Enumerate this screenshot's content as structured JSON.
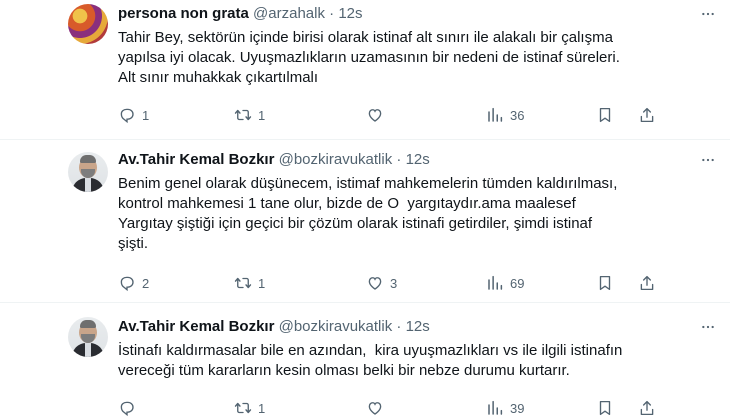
{
  "tweets": [
    {
      "name": "persona non grata",
      "handle": "@arzahalk",
      "dot": "·",
      "time": "12s",
      "text": "Tahir Bey, sektörün içinde birisi olarak istinaf alt sınırı ile alakalı bir çalışma\nyapılsa iyi olacak. Uyuşmazlıkların uzamasının bir nedeni de istinaf süreleri.\nAlt sınır muhakkak çıkartılmalı",
      "replies": "1",
      "retweets": "1",
      "likes": "",
      "views": "36"
    },
    {
      "name": "Av.Tahir Kemal Bozkır",
      "handle": "@bozkiravukatlik",
      "dot": "·",
      "time": "12s",
      "text": "Benim genel olarak düşünecem, istimaf mahkemelerin tümden kaldırılması,\nkontrol mahkemesi 1 tane olur, bizde de O  yargıtaydır.ama maalesef\nYargıtay şiştiği için geçici bir çözüm olarak istinafi getirdiler, şimdi istinaf\nşişti.",
      "replies": "2",
      "retweets": "1",
      "likes": "3",
      "views": "69"
    },
    {
      "name": "Av.Tahir Kemal Bozkır",
      "handle": "@bozkiravukatlik",
      "dot": "·",
      "time": "12s",
      "text": "İstinafı kaldırmasalar bile en azından,  kira uyuşmazlıkları vs ile ilgili istinafın\nvereceği tüm kararların kesin olması belki bir nebze durumu kurtarır.",
      "replies": "",
      "retweets": "1",
      "likes": "",
      "views": "39"
    }
  ],
  "icons": {
    "reply": "reply-icon",
    "retweet": "retweet-icon",
    "like": "heart-icon",
    "views": "views-icon",
    "bookmark": "bookmark-icon",
    "share": "share-icon",
    "more": "more-icon"
  },
  "colors": {
    "text": "#0f1419",
    "secondary": "#536471",
    "divider": "#eff3f4"
  }
}
